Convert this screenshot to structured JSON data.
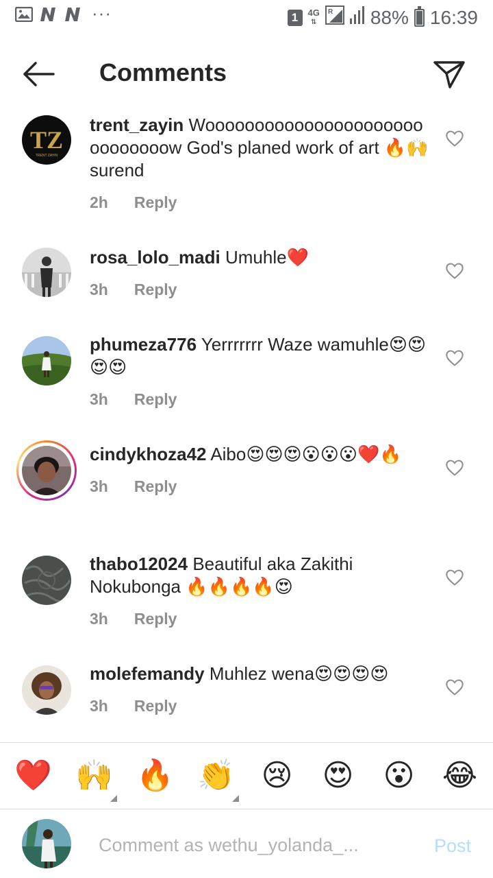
{
  "status_bar": {
    "left_icons": [
      "image-icon",
      "n-icon",
      "n-icon",
      "more-dots-icon"
    ],
    "more_dots": "···",
    "sim_slot": "1",
    "network": "4G",
    "battery_percent": "88%",
    "battery_level": 0.88,
    "time": "16:39"
  },
  "header": {
    "title": "Comments"
  },
  "comments": [
    {
      "username": "trent_zayin",
      "text": "Woooooooooooooooooooooooooooooow  God's planed work of art 🔥🙌surend",
      "time": "2h",
      "reply_label": "Reply"
    },
    {
      "username": "rosa_lolo_madi",
      "text": "Umuhle❤️",
      "time": "3h",
      "reply_label": "Reply"
    },
    {
      "username": "phumeza776",
      "text": "Yerrrrrrr Waze wamuhle😍😍😍😍",
      "time": "3h",
      "reply_label": "Reply"
    },
    {
      "username": "cindykhoza42",
      "text": "Aibo😍😍😍😮😮😮❤️🔥",
      "time": "3h",
      "reply_label": "Reply"
    },
    {
      "username": "thabo12024",
      "text": "Beautiful aka Zakithi Nokubonga 🔥🔥🔥🔥😍",
      "time": "3h",
      "reply_label": "Reply"
    },
    {
      "username": "molefemandy",
      "text": "Muhlez wena😍😍😍😍",
      "time": "3h",
      "reply_label": "Reply"
    }
  ],
  "emoji_bar": [
    "❤️",
    "🙌",
    "🔥",
    "👏",
    "😢",
    "😍",
    "😮",
    "😂"
  ],
  "composer": {
    "placeholder": "Comment as wethu_yolanda_...",
    "post_label": "Post"
  },
  "colors": {
    "text": "#262626",
    "secondary": "#8e8e8e",
    "post_disabled": "#b2dffc",
    "divider": "#dbdbdb"
  }
}
